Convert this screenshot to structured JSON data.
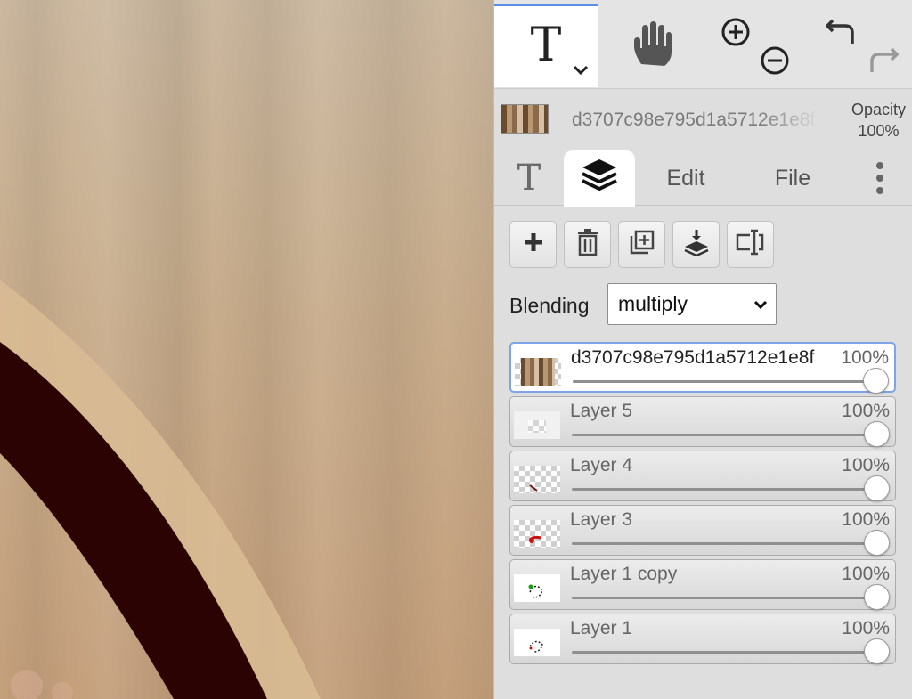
{
  "toolbar": {
    "text_tool_icon": "text-T-icon",
    "text_tool_glyph": "T",
    "hand_tool_icon": "hand-icon",
    "zoom_in_icon": "zoom-in-icon",
    "zoom_out_icon": "zoom-out-icon",
    "undo_icon": "undo-icon",
    "redo_icon": "redo-icon",
    "accent": "#5b8ee6"
  },
  "layer_info": {
    "name": "d3707c98e795d1a5712e1e8f",
    "opacity_label": "Opacity",
    "opacity_value": "100%"
  },
  "tabs": {
    "text_glyph": "T",
    "layers_icon": "layers-icon",
    "edit": "Edit",
    "file": "File",
    "more": "⋮"
  },
  "actions": {
    "add": "add-layer-icon",
    "delete": "delete-layer-icon",
    "duplicate": "duplicate-layer-icon",
    "merge": "merge-down-icon",
    "rename": "rename-layer-icon"
  },
  "blending": {
    "label": "Blending",
    "value": "multiply"
  },
  "layers": [
    {
      "name": "d3707c98e795d1a5712e1e8f",
      "opacity": "100%",
      "active": true
    },
    {
      "name": "Layer 5",
      "opacity": "100%",
      "active": false
    },
    {
      "name": "Layer 4",
      "opacity": "100%",
      "active": false
    },
    {
      "name": "Layer 3",
      "opacity": "100%",
      "active": false
    },
    {
      "name": "Layer 1 copy",
      "opacity": "100%",
      "active": false
    },
    {
      "name": "Layer 1",
      "opacity": "100%",
      "active": false
    }
  ]
}
